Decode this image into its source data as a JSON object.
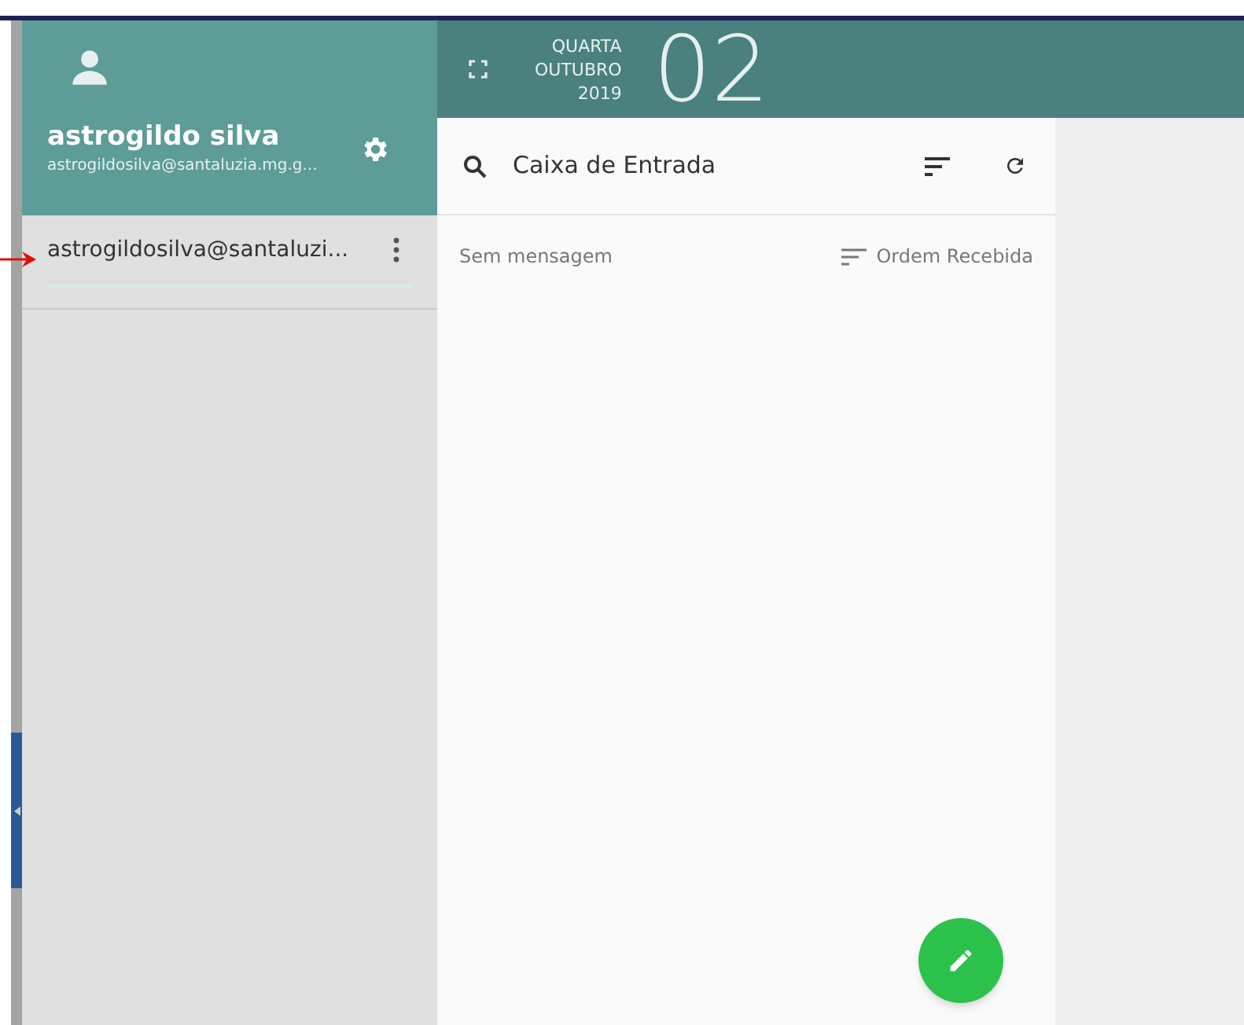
{
  "account": {
    "name": "astrogildo silva",
    "email": "astrogildosilva@santaluzia.mg.g..."
  },
  "accounts": [
    {
      "label": "astrogildosilva@santaluzi...",
      "selected": true
    }
  ],
  "date": {
    "weekday": "QUARTA",
    "month": "OUTUBRO",
    "year": "2019",
    "day": "02"
  },
  "toolbar": {
    "title": "Caixa de Entrada"
  },
  "list": {
    "empty_text": "Sem mensagem",
    "sort_label": "Ordem Recebida"
  }
}
